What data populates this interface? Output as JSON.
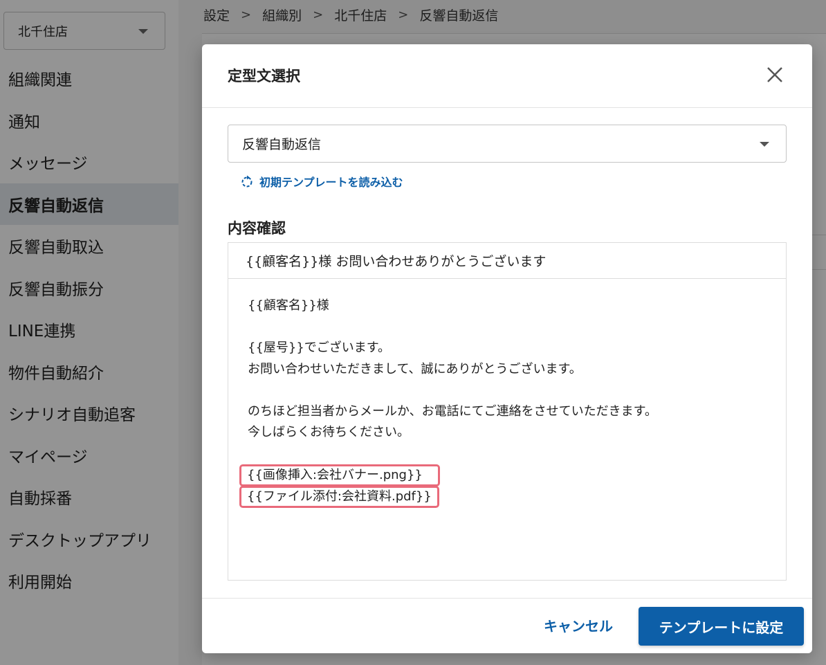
{
  "sidebar": {
    "store_select": "北千住店",
    "items": [
      {
        "label": "組織関連"
      },
      {
        "label": "通知"
      },
      {
        "label": "メッセージ"
      },
      {
        "label": "反響自動返信",
        "active": true
      },
      {
        "label": "反響自動取込"
      },
      {
        "label": "反響自動振分"
      },
      {
        "label": "LINE連携"
      },
      {
        "label": "物件自動紹介"
      },
      {
        "label": "シナリオ自動追客"
      },
      {
        "label": "マイページ"
      },
      {
        "label": "自動採番"
      },
      {
        "label": "デスクトップアプリ"
      },
      {
        "label": "利用開始"
      }
    ]
  },
  "breadcrumb": [
    "設定",
    "組織別",
    "北千住店",
    "反響自動返信"
  ],
  "modal": {
    "title": "定型文選択",
    "template_select": "反響自動返信",
    "reload_link": "初期テンプレートを読み込む",
    "section_title": "内容確認",
    "subject": "{{顧客名}}様 お問い合わせありがとうございます",
    "body": {
      "line1": "{{顧客名}}様",
      "line2": "{{屋号}}でございます。",
      "line3": "お問い合わせいただきまして、誠にありがとうございます。",
      "line4": "のちほど担当者からメールか、お電話にてご連絡をさせていただきます。",
      "line5": "今しばらくお待ちください。",
      "image_tag": "{{画像挿入:会社バナー.png}}",
      "file_tag": "{{ファイル添付:会社資料.pdf}}"
    },
    "cancel_label": "キャンセル",
    "apply_label": "テンプレートに設定"
  },
  "colors": {
    "primary": "#0d5fa8",
    "highlight": "#e96a7a",
    "active_nav": "#e3e8ee"
  }
}
